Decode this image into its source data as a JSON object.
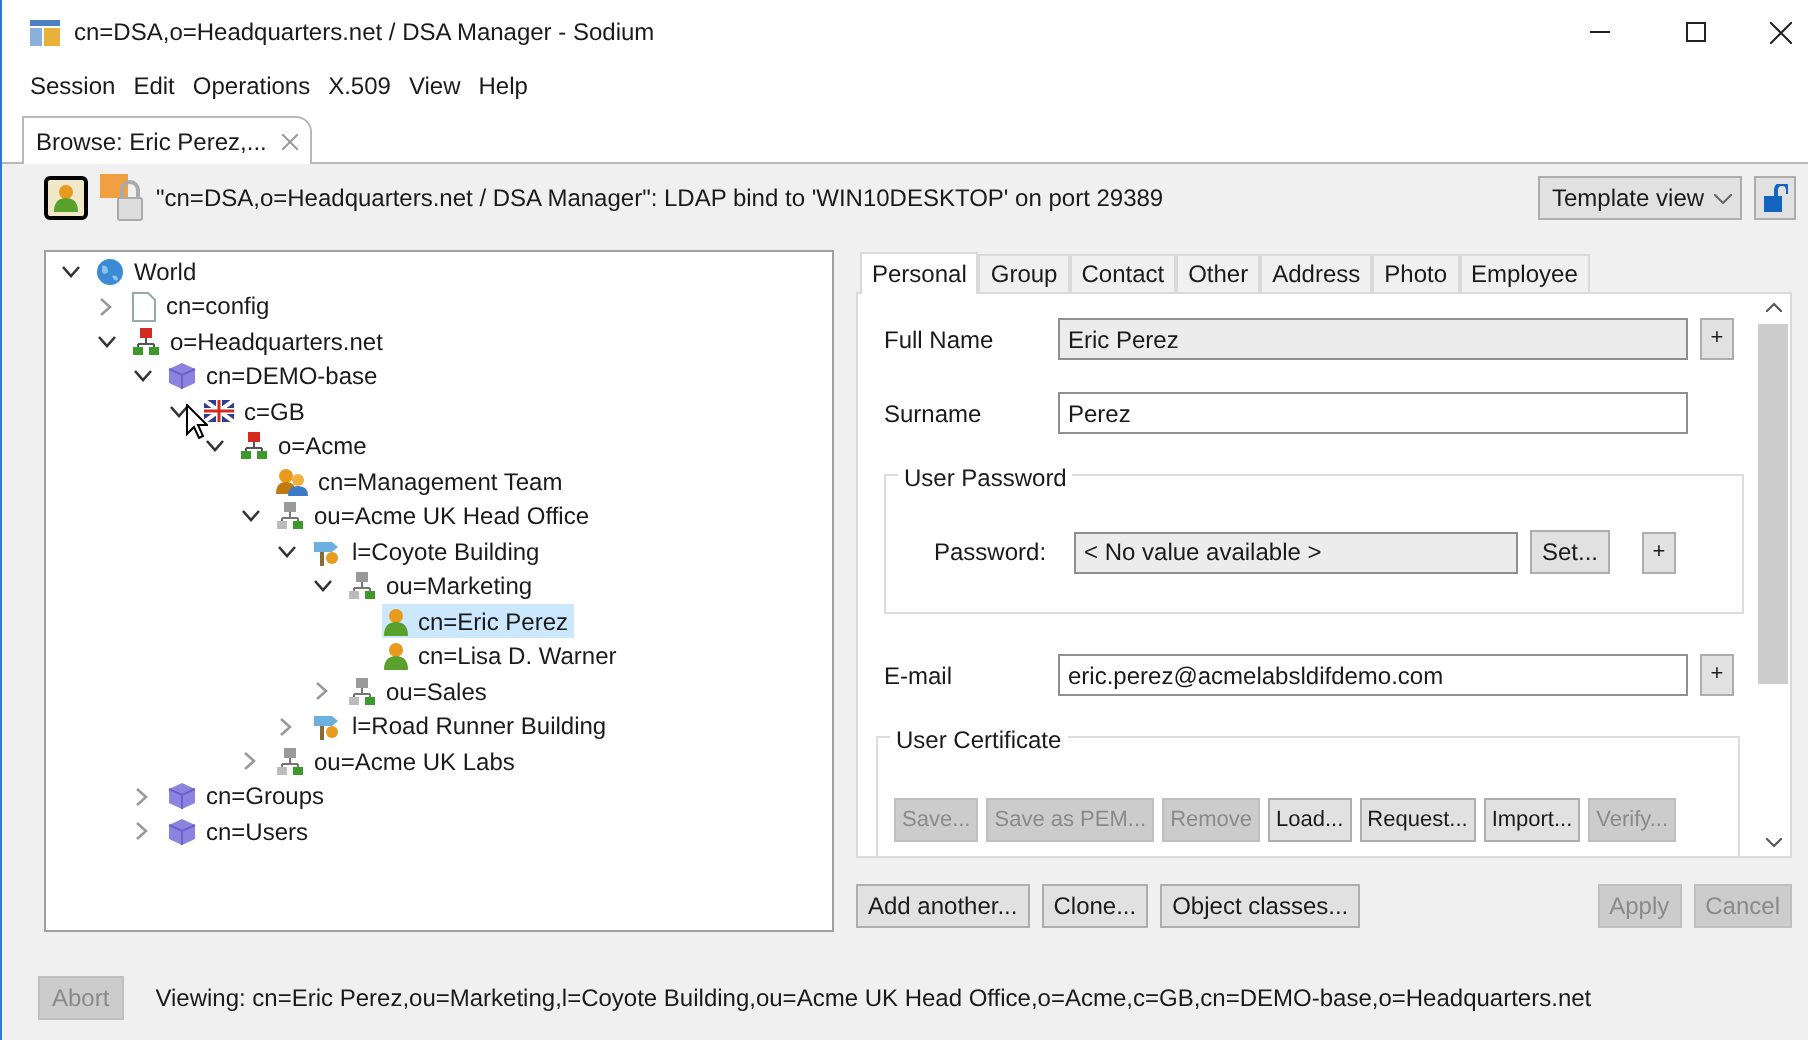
{
  "window": {
    "title": "cn=DSA,o=Headquarters.net / DSA Manager - Sodium"
  },
  "menu": [
    "Session",
    "Edit",
    "Operations",
    "X.509",
    "View",
    "Help"
  ],
  "editor_tabs": [
    {
      "label": "Browse: Eric Perez,...",
      "selected": true
    }
  ],
  "toolbar": {
    "connection": "\"cn=DSA,o=Headquarters.net / DSA Manager\": LDAP bind to 'WIN10DESKTOP' on port 29389",
    "view_dropdown": "Template view"
  },
  "tree": [
    {
      "label": "World",
      "kind": "globe",
      "expanded": true,
      "selected": false,
      "children": [
        {
          "label": "cn=config",
          "kind": "document",
          "expanded": false,
          "selected": false
        },
        {
          "label": "o=Headquarters.net",
          "kind": "organization",
          "expanded": true,
          "selected": false,
          "children": [
            {
              "label": "cn=DEMO-base",
              "kind": "database",
              "expanded": true,
              "selected": false,
              "children": [
                {
                  "label": "c=GB",
                  "kind": "flag",
                  "expanded": true,
                  "selected": false,
                  "children": [
                    {
                      "label": "o=Acme",
                      "kind": "organization",
                      "expanded": true,
                      "selected": false,
                      "children": [
                        {
                          "label": "cn=Management Team",
                          "kind": "group",
                          "selected": false
                        },
                        {
                          "label": "ou=Acme UK Head Office",
                          "kind": "unit",
                          "expanded": true,
                          "selected": false,
                          "children": [
                            {
                              "label": "l=Coyote Building",
                              "kind": "locality",
                              "expanded": true,
                              "selected": false,
                              "children": [
                                {
                                  "label": "ou=Marketing",
                                  "kind": "unit",
                                  "expanded": true,
                                  "selected": false,
                                  "children": [
                                    {
                                      "label": "cn=Eric Perez",
                                      "kind": "person",
                                      "selected": true
                                    },
                                    {
                                      "label": "cn=Lisa D. Warner",
                                      "kind": "person",
                                      "selected": false
                                    }
                                  ]
                                },
                                {
                                  "label": "ou=Sales",
                                  "kind": "unit",
                                  "expanded": false,
                                  "selected": false
                                }
                              ]
                            },
                            {
                              "label": "l=Road Runner Building",
                              "kind": "locality",
                              "expanded": false,
                              "selected": false
                            }
                          ]
                        },
                        {
                          "label": "ou=Acme UK Labs",
                          "kind": "unit",
                          "expanded": false,
                          "selected": false
                        }
                      ]
                    }
                  ]
                }
              ]
            },
            {
              "label": "cn=Groups",
              "kind": "database",
              "expanded": false,
              "selected": false
            },
            {
              "label": "cn=Users",
              "kind": "database",
              "expanded": false,
              "selected": false
            }
          ]
        }
      ]
    }
  ],
  "entry_tabs": [
    {
      "label": "Personal",
      "selected": true
    },
    {
      "label": "Group",
      "selected": false
    },
    {
      "label": "Contact",
      "selected": false
    },
    {
      "label": "Other",
      "selected": false
    },
    {
      "label": "Address",
      "selected": false
    },
    {
      "label": "Photo",
      "selected": false
    },
    {
      "label": "Employee",
      "selected": false
    }
  ],
  "form": [
    {
      "kind": "field",
      "label": "Full Name",
      "value": "Eric Perez",
      "readonly": true,
      "add_button": "+"
    },
    {
      "kind": "field",
      "label": "Surname",
      "value": "Perez",
      "readonly": false
    },
    {
      "kind": "password",
      "title": "User Password",
      "label": "Password:",
      "value": "< No value available >",
      "set_button": "Set...",
      "add_button": "+"
    },
    {
      "kind": "field",
      "label": "E-mail",
      "value": "eric.perez@acmelabsldifdemo.com",
      "readonly": false,
      "add_button": "+"
    },
    {
      "kind": "certificate",
      "title": "User Certificate",
      "buttons": [
        {
          "label": "Save...",
          "disabled": true
        },
        {
          "label": "Save as PEM...",
          "disabled": true
        },
        {
          "label": "Remove",
          "disabled": true
        },
        {
          "label": "Load...",
          "disabled": false
        },
        {
          "label": "Request...",
          "disabled": false
        },
        {
          "label": "Import...",
          "disabled": false
        },
        {
          "label": "Verify...",
          "disabled": true
        }
      ]
    }
  ],
  "actions_left": [
    {
      "label": "Add another...",
      "disabled": false
    },
    {
      "label": "Clone...",
      "disabled": false
    },
    {
      "label": "Object classes...",
      "disabled": false
    }
  ],
  "actions_right": [
    {
      "label": "Apply",
      "disabled": true
    },
    {
      "label": "Cancel",
      "disabled": true
    }
  ],
  "status_bar": {
    "abort": {
      "label": "Abort",
      "disabled": true
    },
    "text": "Viewing: cn=Eric Perez,ou=Marketing,l=Coyote Building,ou=Acme UK Head Office,o=Acme,c=GB,cn=DEMO-base,o=Headquarters.net"
  }
}
